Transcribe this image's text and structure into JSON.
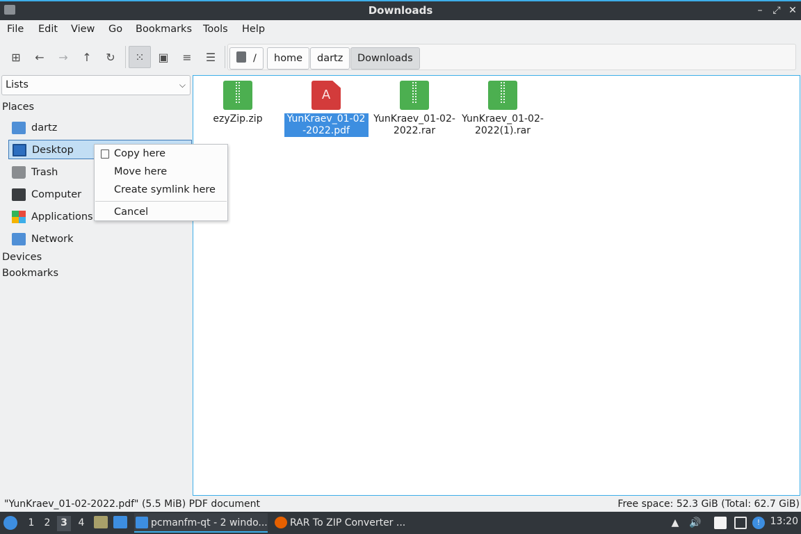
{
  "window": {
    "title": "Downloads",
    "controls": {
      "minimize": "–",
      "maximize": "⤢",
      "close": "✕"
    }
  },
  "menubar": [
    "File",
    "Edit",
    "View",
    "Go",
    "Bookmarks",
    "Tools",
    "Help"
  ],
  "toolbar": {
    "icons": {
      "new_tab": "new-tab-icon",
      "back": "arrow-left-icon",
      "forward": "arrow-right-icon",
      "up": "arrow-up-icon",
      "reload": "reload-icon",
      "icon_view": "grid-icon",
      "thumbnail_view": "image-icon",
      "compact_view": "list-icon",
      "detailed_view": "detailed-list-icon"
    },
    "glyphs": {
      "new_tab": "⊞",
      "back": "←",
      "forward": "→",
      "up": "↑",
      "reload": "↻",
      "icon_view": "⁙",
      "thumbnail_view": "▣",
      "compact_view": "≡",
      "detailed_view": "☰"
    }
  },
  "breadcrumb": [
    "/",
    "home",
    "dartz",
    "Downloads"
  ],
  "sidepane": {
    "view_mode": "Lists",
    "sections": {
      "places": "Places",
      "devices": "Devices",
      "bookmarks": "Bookmarks"
    },
    "places": [
      {
        "label": "dartz",
        "icon": "home-folder-icon"
      },
      {
        "label": "Desktop",
        "icon": "desktop-icon"
      },
      {
        "label": "Trash",
        "icon": "trash-icon"
      },
      {
        "label": "Computer",
        "icon": "computer-icon"
      },
      {
        "label": "Applications",
        "icon": "applications-icon"
      },
      {
        "label": "Network",
        "icon": "network-folder-icon"
      }
    ]
  },
  "context_menu": {
    "items": [
      "Copy here",
      "Move here",
      "Create symlink here"
    ],
    "cancel": "Cancel"
  },
  "files": [
    {
      "name": "ezyZip.zip",
      "type": "archive"
    },
    {
      "name": "YunKraev_01-02-2022.pdf",
      "type": "pdf",
      "selected": true
    },
    {
      "name": "YunKraev_01-02-2022.rar",
      "type": "archive"
    },
    {
      "name": "YunKraev_01-02-2022(1).rar",
      "type": "archive"
    }
  ],
  "status": {
    "left": "\"YunKraev_01-02-2022.pdf\" (5.5 MiB) PDF document",
    "right": "Free space: 52.3 GiB (Total: 62.7 GiB)"
  },
  "taskbar": {
    "desktops": [
      "1",
      "2",
      "3",
      "4"
    ],
    "active_desktop": "3",
    "tasks": [
      {
        "label": "pcmanfm-qt - 2 windo...",
        "icon": "file-manager-icon"
      },
      {
        "label": "RAR To ZIP Converter ...",
        "icon": "firefox-icon"
      }
    ],
    "clock": "13:20",
    "tray_icons": [
      "network-up-icon",
      "volume-icon",
      "clipboard-icon",
      "monitor-icon",
      "update-notifier-icon"
    ]
  }
}
